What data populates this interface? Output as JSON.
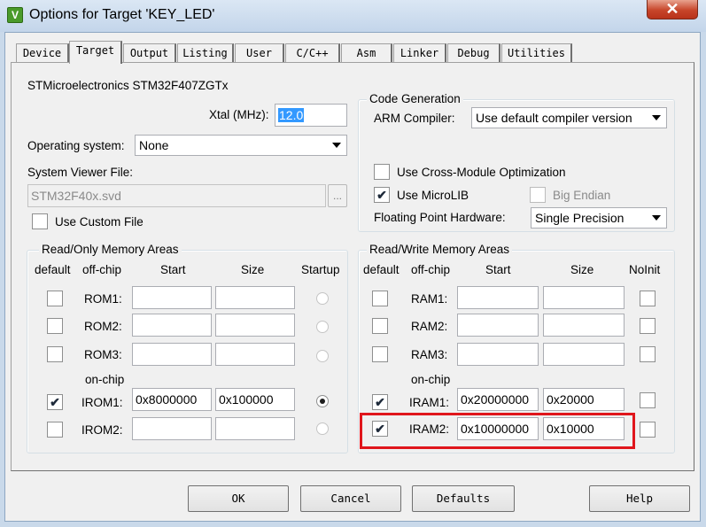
{
  "window": {
    "title": "Options for Target 'KEY_LED'",
    "app_icon": "uvision-icon",
    "close_glyph": "✕"
  },
  "tabs": [
    {
      "label": "Device"
    },
    {
      "label": "Target"
    },
    {
      "label": "Output"
    },
    {
      "label": "Listing"
    },
    {
      "label": "User"
    },
    {
      "label": "C/C++"
    },
    {
      "label": "Asm"
    },
    {
      "label": "Linker"
    },
    {
      "label": "Debug"
    },
    {
      "label": "Utilities"
    }
  ],
  "active_tab": "Target",
  "device_name": "STMicroelectronics STM32F407ZGTx",
  "xtal": {
    "label": "Xtal (MHz):",
    "value": "12.0"
  },
  "os": {
    "label": "Operating system:",
    "value": "None"
  },
  "svd": {
    "label": "System Viewer File:",
    "value": "STM32F40x.svd",
    "browse": "...",
    "custom_label": "Use Custom File",
    "custom_checked": false
  },
  "codegen": {
    "title": "Code Generation",
    "compiler_label": "ARM Compiler:",
    "compiler_value": "Use default compiler version",
    "cross_module": {
      "label": "Use Cross-Module Optimization",
      "checked": false
    },
    "microlib": {
      "label": "Use MicroLIB",
      "checked": true,
      "mark": "✔"
    },
    "big_endian": {
      "label": "Big Endian",
      "checked": false
    },
    "fpu_label": "Floating Point Hardware:",
    "fpu_value": "Single Precision"
  },
  "rom": {
    "title": "Read/Only Memory Areas",
    "headers": {
      "default": "default",
      "offchip": "off-chip",
      "start": "Start",
      "size": "Size",
      "startup": "Startup"
    },
    "onchip_label": "on-chip",
    "rows": [
      {
        "name": "ROM1:",
        "default": false,
        "start": "",
        "size": "",
        "startup": false
      },
      {
        "name": "ROM2:",
        "default": false,
        "start": "",
        "size": "",
        "startup": false
      },
      {
        "name": "ROM3:",
        "default": false,
        "start": "",
        "size": "",
        "startup": false
      },
      {
        "name": "IROM1:",
        "default": true,
        "start": "0x8000000",
        "size": "0x100000",
        "startup": true
      },
      {
        "name": "IROM2:",
        "default": false,
        "start": "",
        "size": "",
        "startup": false
      }
    ]
  },
  "ram": {
    "title": "Read/Write Memory Areas",
    "headers": {
      "default": "default",
      "offchip": "off-chip",
      "start": "Start",
      "size": "Size",
      "noinit": "NoInit"
    },
    "onchip_label": "on-chip",
    "rows": [
      {
        "name": "RAM1:",
        "default": false,
        "start": "",
        "size": "",
        "noinit": false
      },
      {
        "name": "RAM2:",
        "default": false,
        "start": "",
        "size": "",
        "noinit": false
      },
      {
        "name": "RAM3:",
        "default": false,
        "start": "",
        "size": "",
        "noinit": false
      },
      {
        "name": "IRAM1:",
        "default": true,
        "start": "0x20000000",
        "size": "0x20000",
        "noinit": false
      },
      {
        "name": "IRAM2:",
        "default": true,
        "start": "0x10000000",
        "size": "0x10000",
        "noinit": false
      }
    ]
  },
  "check_mark": "✔",
  "highlight_color": "#e0161c",
  "buttons": {
    "ok": "OK",
    "cancel": "Cancel",
    "defaults": "Defaults",
    "help": "Help"
  }
}
